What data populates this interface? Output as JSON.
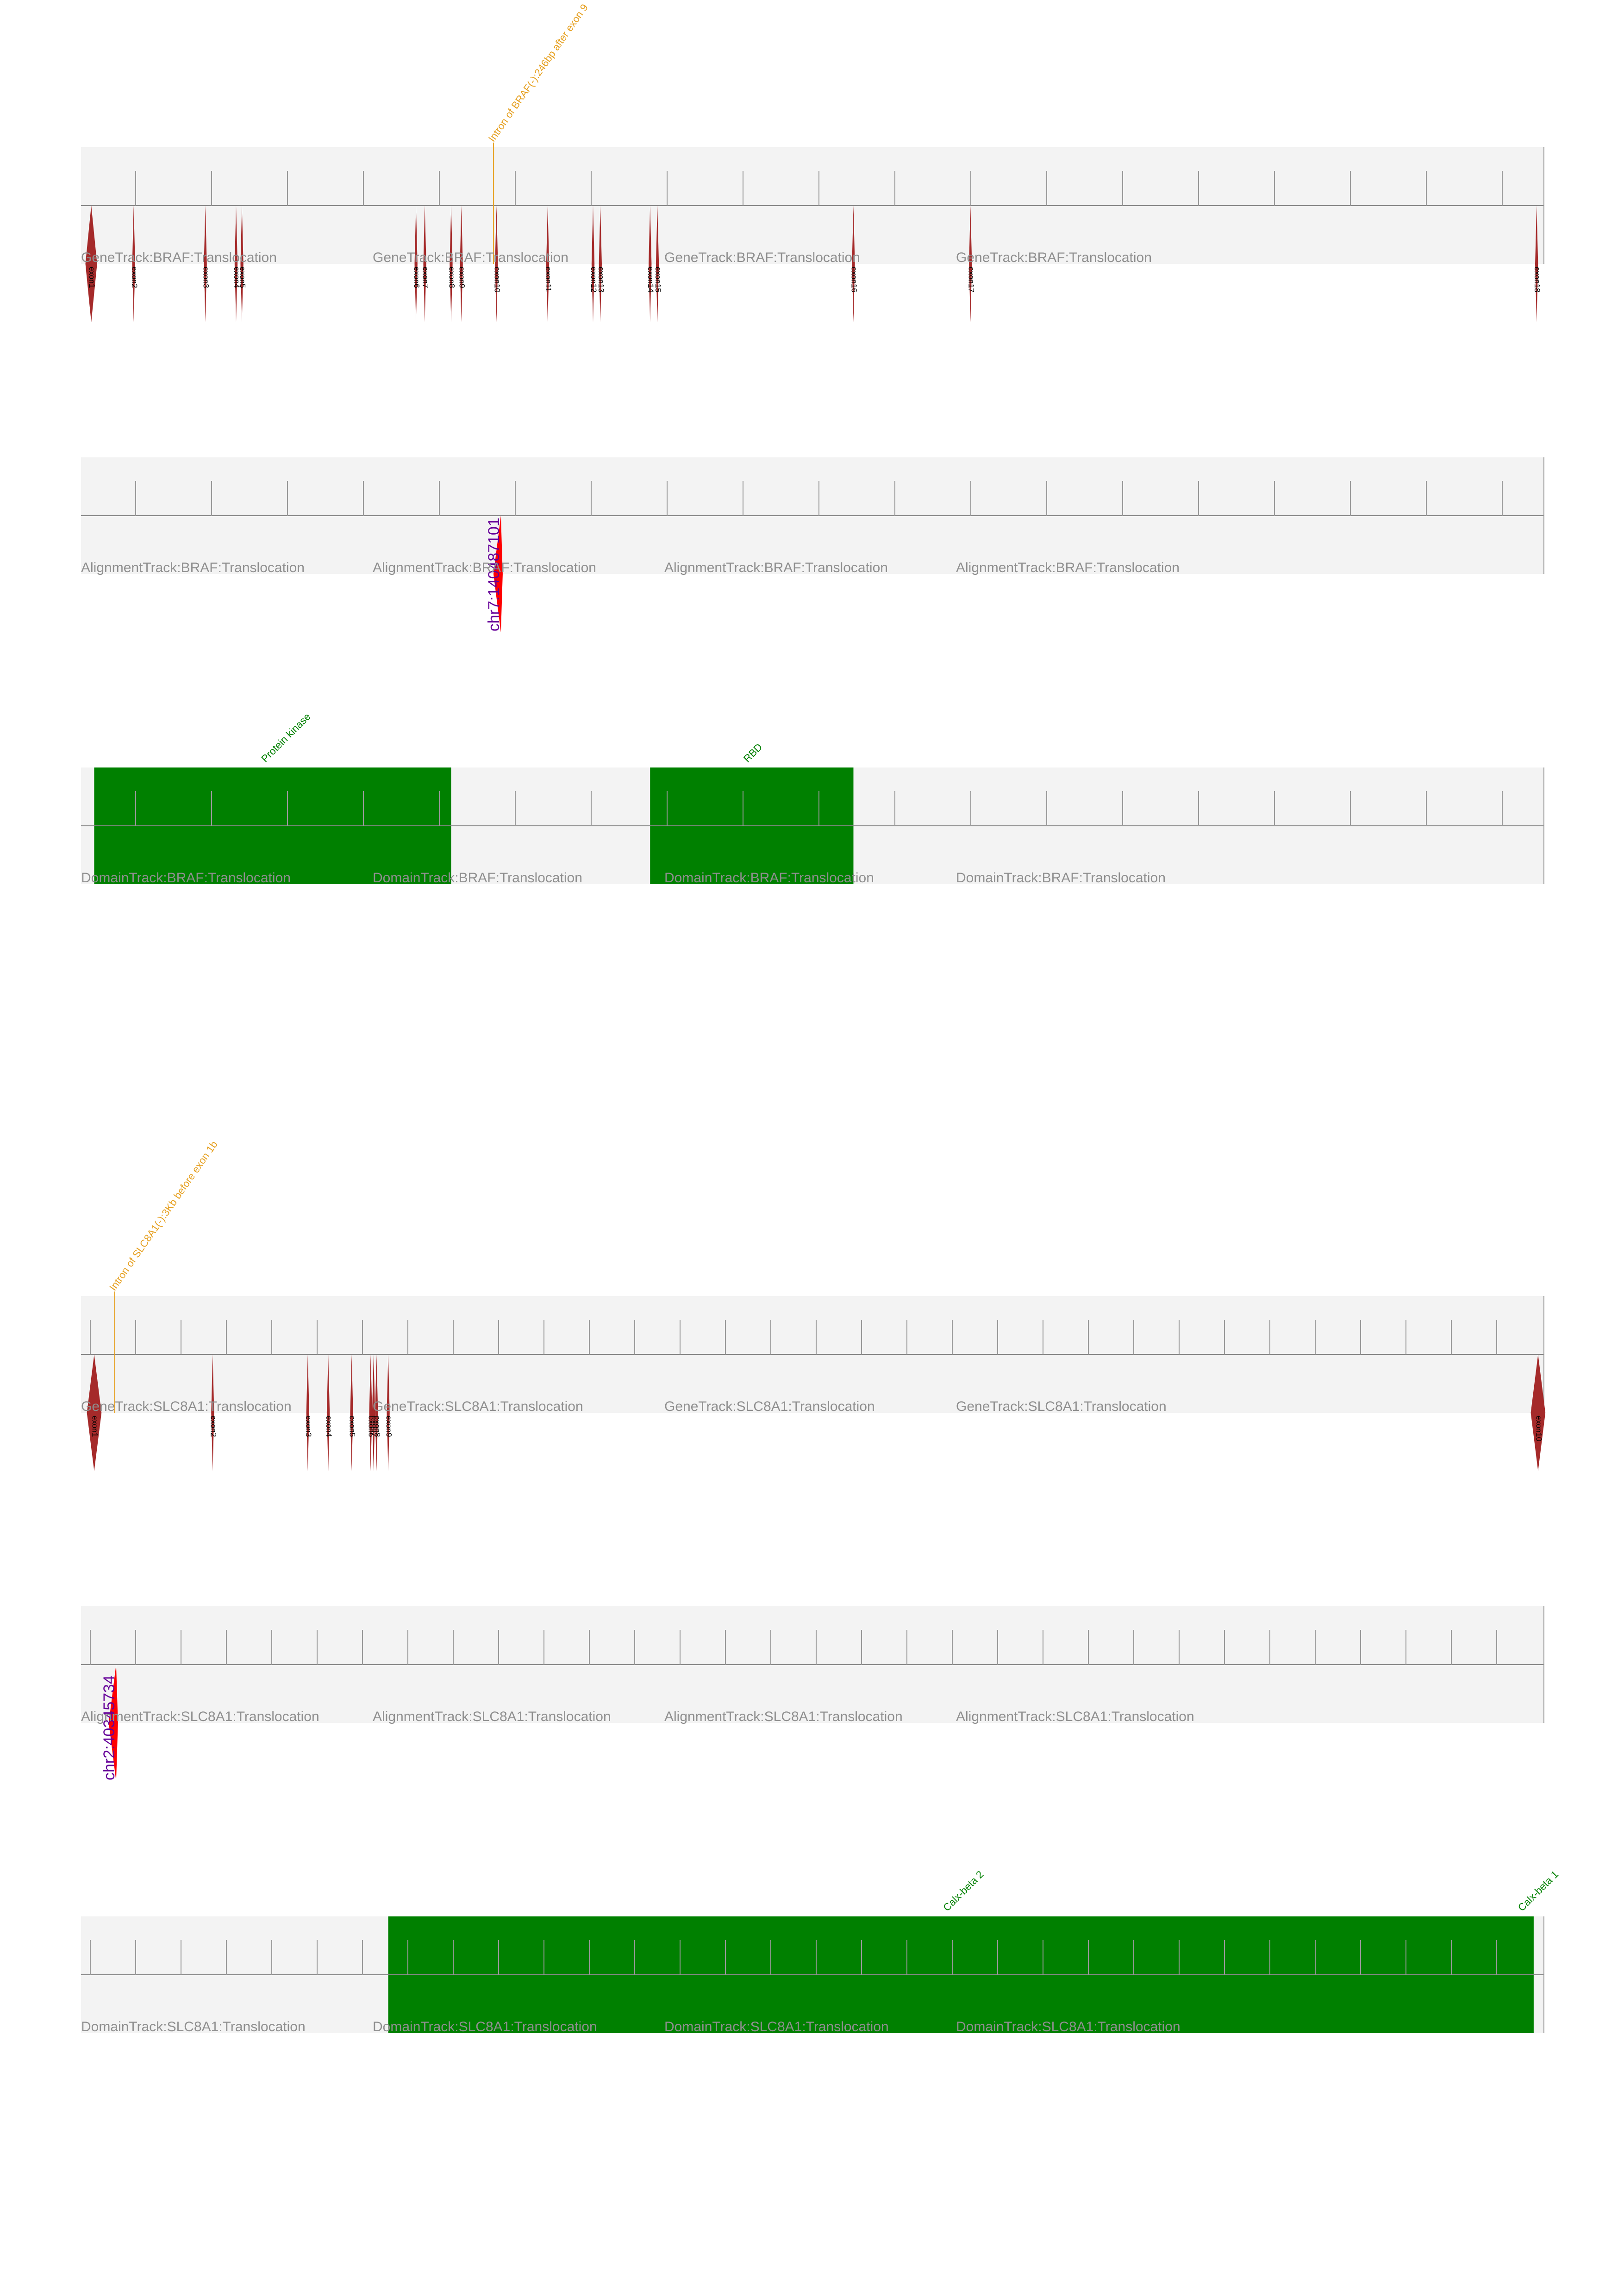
{
  "colors": {
    "track_bg": "#f3f3f3",
    "axis": "#888888",
    "tick": "#999999",
    "exon": "#a52a2a",
    "breakpoint": "#e6a020",
    "alignment": "#ff0000",
    "alignment_label": "#660099",
    "domain": "#008000",
    "track_label": "#8f8f8f",
    "exon_label": "#000000"
  },
  "panels": [
    {
      "gene": "BRAF",
      "tracks": [
        {
          "kind": "gene",
          "labels": [
            "GeneTrack:BRAF:Translocation",
            "GeneTrack:BRAF:Translocation",
            "GeneTrack:BRAF:Translocation",
            "GeneTrack:BRAF:Translocation"
          ],
          "exons": [
            {
              "label": "exon1",
              "pos": 0.007,
              "half": 0.004
            },
            {
              "label": "exon2",
              "pos": 0.036,
              "half": 0.001
            },
            {
              "label": "exon3",
              "pos": 0.085,
              "half": 0.001
            },
            {
              "label": "exon4",
              "pos": 0.106,
              "half": 0.001
            },
            {
              "label": "exon5",
              "pos": 0.11,
              "half": 0.001
            },
            {
              "label": "exon6",
              "pos": 0.229,
              "half": 0.001
            },
            {
              "label": "exon7",
              "pos": 0.235,
              "half": 0.001
            },
            {
              "label": "exon8",
              "pos": 0.253,
              "half": 0.001
            },
            {
              "label": "exon9",
              "pos": 0.26,
              "half": 0.001
            },
            {
              "label": "exon10",
              "pos": 0.284,
              "half": 0.001
            },
            {
              "label": "exon11",
              "pos": 0.319,
              "half": 0.001
            },
            {
              "label": "exon12",
              "pos": 0.35,
              "half": 0.001
            },
            {
              "label": "exon13",
              "pos": 0.355,
              "half": 0.001
            },
            {
              "label": "exon14",
              "pos": 0.389,
              "half": 0.001
            },
            {
              "label": "exon15",
              "pos": 0.394,
              "half": 0.001
            },
            {
              "label": "exon16",
              "pos": 0.528,
              "half": 0.001
            },
            {
              "label": "exon17",
              "pos": 0.608,
              "half": 0.001
            },
            {
              "label": "exon18",
              "pos": 0.995,
              "half": 0.001
            }
          ],
          "breakpoint": {
            "pos": 0.282,
            "label": "Intron of BRAF(-):246bp after exon 9"
          }
        },
        {
          "kind": "alignment",
          "labels": [
            "AlignmentTrack:BRAF:Translocation",
            "AlignmentTrack:BRAF:Translocation",
            "AlignmentTrack:BRAF:Translocation",
            "AlignmentTrack:BRAF:Translocation"
          ],
          "read": {
            "pos": 0.287,
            "label": "chr7:140487101"
          }
        },
        {
          "kind": "domain",
          "labels": [
            "DomainTrack:BRAF:Translocation",
            "DomainTrack:BRAF:Translocation",
            "DomainTrack:BRAF:Translocation",
            "DomainTrack:BRAF:Translocation"
          ],
          "domains": [
            {
              "name": "Protein kinase",
              "start": 0.009,
              "end": 0.253
            },
            {
              "name": "RBD",
              "start": 0.389,
              "end": 0.528
            }
          ]
        }
      ]
    },
    {
      "gene": "SLC8A1",
      "tracks": [
        {
          "kind": "gene",
          "labels": [
            "GeneTrack:SLC8A1:Translocation",
            "GeneTrack:SLC8A1:Translocation",
            "GeneTrack:SLC8A1:Translocation",
            "GeneTrack:SLC8A1:Translocation"
          ],
          "exons": [
            {
              "label": "exon1",
              "pos": 0.009,
              "half": 0.005
            },
            {
              "label": "exon2",
              "pos": 0.09,
              "half": 0.001
            },
            {
              "label": "exon3",
              "pos": 0.155,
              "half": 0.001
            },
            {
              "label": "exon4",
              "pos": 0.169,
              "half": 0.001
            },
            {
              "label": "exon5",
              "pos": 0.185,
              "half": 0.001
            },
            {
              "label": "exon6",
              "pos": 0.198,
              "half": 0.001
            },
            {
              "label": "exon7",
              "pos": 0.2,
              "half": 0.001
            },
            {
              "label": "exon8",
              "pos": 0.202,
              "half": 0.001
            },
            {
              "label": "exon9",
              "pos": 0.21,
              "half": 0.001
            },
            {
              "label": "exon10",
              "pos": 0.996,
              "half": 0.005
            }
          ],
          "breakpoint": {
            "pos": 0.023,
            "label": "Intron of SLC8A1(-):3Kb before exon 1b"
          }
        },
        {
          "kind": "alignment",
          "labels": [
            "AlignmentTrack:SLC8A1:Translocation",
            "AlignmentTrack:SLC8A1:Translocation",
            "AlignmentTrack:SLC8A1:Translocation",
            "AlignmentTrack:SLC8A1:Translocation"
          ],
          "read": {
            "pos": 0.024,
            "label": "chr2:40345734"
          }
        },
        {
          "kind": "domain",
          "labels": [
            "DomainTrack:SLC8A1:Translocation",
            "DomainTrack:SLC8A1:Translocation",
            "DomainTrack:SLC8A1:Translocation",
            "DomainTrack:SLC8A1:Translocation"
          ],
          "domains": [
            {
              "name": "Calx-beta 2",
              "start": 0.21,
              "end": 0.6
            },
            {
              "name": "Calx-beta 1",
              "start": 0.6,
              "end": 0.993
            }
          ]
        }
      ]
    }
  ]
}
